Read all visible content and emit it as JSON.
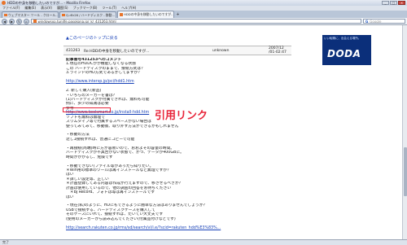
{
  "window": {
    "title": "HDDの中身を移動したいのですが… - Mozilla Firefox"
  },
  "menu": [
    "ファイル(F)",
    "編集(E)",
    "表示(V)",
    "履歴(S)",
    "ブックマーク(B)",
    "ツール(T)",
    "ヘルプ(H)"
  ],
  "tabs": [
    {
      "label": "ウェブマスター ツール - クロール…"
    },
    {
      "label": "Q-rBr26 / ハードディスク - 移動…"
    },
    {
      "label": "HDDの中身を移動したいのですが…"
    }
  ],
  "address": {
    "url": "windowsxp.tunlife.pasokona.jp/_k/_431263.html"
  },
  "search": {
    "placeholder": "Google"
  },
  "page": {
    "top_link": "▲このページのトップに戻る",
    "entry": {
      "id": "431263",
      "subject": "Re:HDDの中身を移動したいのですが…",
      "author": "unknown",
      "date_line1": "2007/12",
      "date_line2": "/01-02:47"
    },
    "lines": [
      "記事番号431253へのコメント",
      "1.現在のHDDCがが機能しなくなる状態",
      "この ハードディスクのままで、接続方式は？",
      "3.ラインドのHD方式であるかしてますか？",
      "",
      "http://www.intersp.jp/pci/hdd1.htm",
      "",
      "2. 新しく購入(新品)",
      "・いちらのメーカーを書は？",
      "(1)ハードディスクが付属できれば、無料も可能",
      "例に、多少の知識は必要",
      "参考",
      "http://www.koolsmart.co.jp/install-hdd.htm",
      "ソフトも無料は無理で",
      "スリムタイプ等で付属するスペースがない場合は",
      "使ってみてみて、移動後、取り外す方法ができるかもしれません",
      "",
      "・移動の方法",
      "近し1接続すれば、普通にコピーで可能",
      "",
      "・再接続(両端)時に方が容易いので、おおよその容量の時間。",
      "ハードディスクが不具合がない状態で、かつ、データが400GBに。",
      "時間がかかるし、危険です",
      "",
      "・移動できない(ファイル等があったら知りたい。",
      "＊Win用の標準のツールは再インストールなど無理ですか？",
      "はい",
      "＊詳しい設定等、正しい",
      "＊計画登録してある内容は作成が行えますので、移させるべきか？",
      "計画は使用しているので、他の調査の回答をお待ちください",
      "　＊BJ Record、フォトは等は再インストールです",
      "はい",
      "",
      "・現在(私)のように、HDにもできるように簡単な方法はありませんでしょうか？",
      "USBで接続する、ハードディスクケースを購入して",
      "そのケースにいれて、接続すれば、たいてい大丈夫です",
      "(使用のメーカーから読み込んでください(付属品付けなどです)",
      "",
      "http://search.rakuten.co.jp/rms/sd/search/vl/i.e/?scid=rakuten_hdd%E3%83%..."
    ],
    "link_lines": [
      5,
      12,
      38
    ],
    "bold_lines": [
      0
    ]
  },
  "annotation": {
    "label": "引用リンク",
    "color": "#e8253a"
  },
  "ad": {
    "tagline": "いい転職に、出会える場所。",
    "brand": "DODA"
  },
  "status": {
    "text": "完了"
  }
}
